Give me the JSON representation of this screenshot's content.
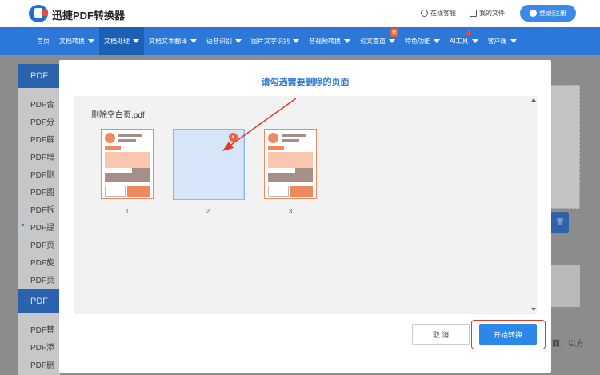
{
  "header": {
    "brand": "迅捷PDF转换器",
    "online_service": "在线客服",
    "my_files": "我的文件",
    "login": "登录|注册"
  },
  "nav": {
    "items": [
      "首页",
      "文档转换",
      "文档处理",
      "文档文本翻译",
      "语音识别",
      "图片文字识别",
      "音视频转换",
      "论文查重",
      "特色功能",
      "AI工具",
      "客户端"
    ],
    "new_badge": "新"
  },
  "background": {
    "side_heads": [
      "PDF",
      "PDF"
    ],
    "side_items": [
      "PDF合",
      "PDF分",
      "PDF解",
      "PDF增",
      "PDF删",
      "PDF图",
      "PDF拆",
      "PDF提",
      "PDF页",
      "PDF旋",
      "PDF页"
    ],
    "side_items_2": [
      "PDF替",
      "PDF添",
      "PDF删"
    ],
    "right_button": "置",
    "right_text": "面，以方"
  },
  "modal": {
    "title": "请勾选需要删除的页面",
    "filename": "删除空白页.pdf",
    "pages": [
      "1",
      "2",
      "3"
    ],
    "selected_page": "2",
    "cancel": "取 消",
    "start": "开始转换"
  },
  "colors": {
    "primary": "#2b78d8",
    "accent": "#e8603c",
    "highlight": "#e0392b"
  }
}
